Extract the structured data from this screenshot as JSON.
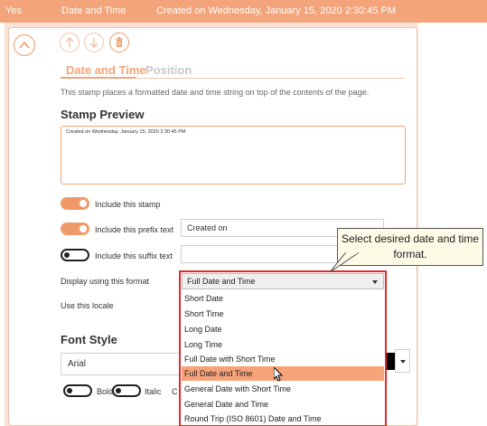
{
  "header": {
    "yes": "Yes",
    "type": "Date and Time",
    "summary": "Created on Wednesday, January 15, 2020 2:30:45 PM"
  },
  "tabs": [
    {
      "label": "Date and Time",
      "active": true
    },
    {
      "label": "Position",
      "active": false
    }
  ],
  "description": "This stamp places a formatted date and time string on top of the contents of the page.",
  "preview": {
    "heading": "Stamp Preview",
    "text": "Created on Wednesday, January 15, 2020 2:30:45 PM"
  },
  "options": {
    "include_stamp": {
      "label": "Include this stamp",
      "on": true
    },
    "include_prefix": {
      "label": "Include this prefix text",
      "on": true,
      "value": "Created on"
    },
    "include_suffix": {
      "label": "Include this suffix text",
      "on": false,
      "value": ""
    }
  },
  "format": {
    "label": "Display using this format",
    "selected": "Full Date and Time",
    "items": [
      "Short Date",
      "Short Time",
      "Long Date",
      "Long Time",
      "Full Date with Short Time",
      "Full Date and Time",
      "General Date with Short Time",
      "General Date and Time",
      "Round Trip (ISO 8601) Date and Time"
    ],
    "highlighted_index": 5
  },
  "locale": {
    "label": "Use this locale"
  },
  "callout": "Select desired date and time format.",
  "font": {
    "heading": "Font Style",
    "family": "Arial",
    "bold_label": "Bold",
    "italic_label": "Italic",
    "trailing_char": "C",
    "color": "#000000"
  },
  "colors": {
    "accent": "#f3a47a",
    "highlight": "#f7a37a",
    "outline": "#e3292b"
  }
}
